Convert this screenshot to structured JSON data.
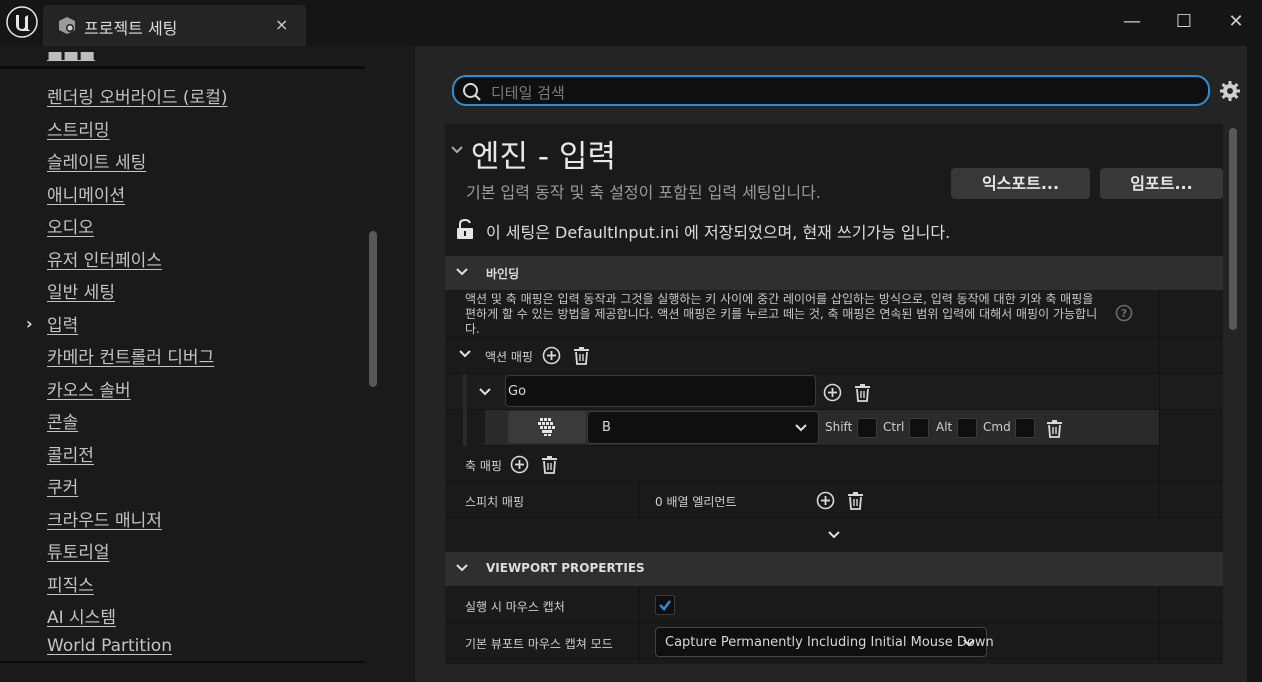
{
  "window": {
    "tab_title": "프로젝트 세팅",
    "tab_close": "×",
    "minimize": "—",
    "maximize": "☐",
    "close": "✕"
  },
  "sidebar": {
    "items": [
      {
        "label": "렌더링 오버라이드 (로컬)"
      },
      {
        "label": "스트리밍"
      },
      {
        "label": "슬레이트 세팅"
      },
      {
        "label": "애니메이션"
      },
      {
        "label": "오디오"
      },
      {
        "label": "유저 인터페이스"
      },
      {
        "label": "일반 세팅"
      },
      {
        "label": "입력",
        "selected": true
      },
      {
        "label": "카메라 컨트롤러 디버그"
      },
      {
        "label": "카오스 솔버"
      },
      {
        "label": "콘솔"
      },
      {
        "label": "콜리전"
      },
      {
        "label": "쿠커"
      },
      {
        "label": "크라우드 매니저"
      },
      {
        "label": "튜토리얼"
      },
      {
        "label": "피직스"
      },
      {
        "label": "AI 시스템"
      },
      {
        "label": "World Partition"
      }
    ]
  },
  "search": {
    "placeholder": "디테일 검색"
  },
  "header": {
    "title": "엔진 - 입력",
    "description": "기본 입력 동작 및 축 설정이 포함된 입력 세팅입니다.",
    "export_label": "익스포트...",
    "import_label": "임포트...",
    "notice": "이 세팅은 DefaultInput.ini 에 저장되었으며, 현재 쓰기가능 입니다."
  },
  "bindings": {
    "section_label": "바인딩",
    "description": "액션 및 축 매핑은 입력 동작과 그것을 실행하는 키 사이에 중간 레이어를 삽입하는 방식으로, 입력 동작에 대한 키와 축 매핑을 편하게 할 수 있는 방법을 제공합니다. 액션 매핑은 키를 누르고 떼는 것, 축 매핑은 연속된 범위 입력에 대해서 매핑이 가능합니다.",
    "action_mappings_label": "액션 매핑",
    "action_name": "Go",
    "key_value": "B",
    "modifiers": [
      "Shift",
      "Ctrl",
      "Alt",
      "Cmd"
    ],
    "axis_mappings_label": "축 매핑",
    "speech_mappings_label": "스피치 매핑",
    "speech_mappings_value": "0 배열 엘리먼트"
  },
  "viewport": {
    "section_label": "VIEWPORT PROPERTIES",
    "capture_label": "실행 시 마우스 캡처",
    "capture_checked": true,
    "capture_mode_label": "기본 뷰포트 마우스 캡쳐 모드",
    "capture_mode_value": "Capture Permanently Including Initial Mouse Down"
  },
  "colors": {
    "accent": "#2c8fd6",
    "background": "#151515",
    "panel": "#242424"
  }
}
